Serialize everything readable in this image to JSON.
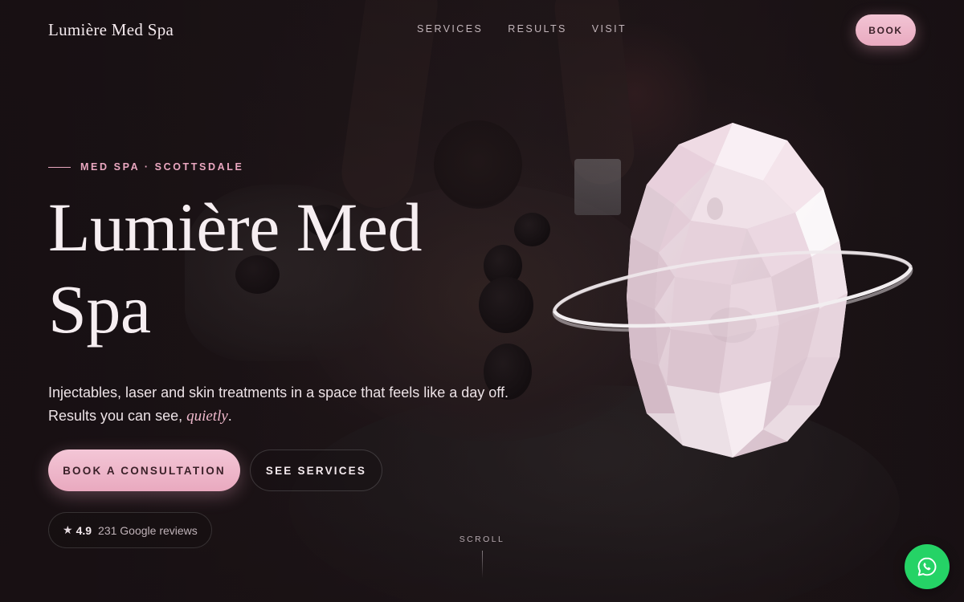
{
  "header": {
    "brand": "Lumière Med Spa",
    "nav": [
      "SERVICES",
      "RESULTS",
      "VISIT"
    ],
    "book_label": "BOOK"
  },
  "hero": {
    "eyebrow": "MED SPA · SCOTTSDALE",
    "title_line1": "Lumière Med",
    "title_line2": "Spa",
    "lede_line1": "Injectables, laser and skin treatments in a space that feels like a day off.",
    "lede_line2_pre": "Results you can see, ",
    "lede_line2_em": "quietly",
    "lede_line2_post": ".",
    "primary_cta": "BOOK A CONSULTATION",
    "secondary_cta": "SEE SERVICES",
    "rating": {
      "star": "★",
      "score": "4.9",
      "reviews": "231 Google reviews"
    },
    "scroll_label": "SCROLL"
  },
  "icons": {
    "whatsapp": "whatsapp-icon",
    "gem": "faceted-gem-illustration"
  },
  "colors": {
    "accent_pink": "#ecafc4",
    "background": "#1a1214",
    "whatsapp_green": "#25d366"
  }
}
